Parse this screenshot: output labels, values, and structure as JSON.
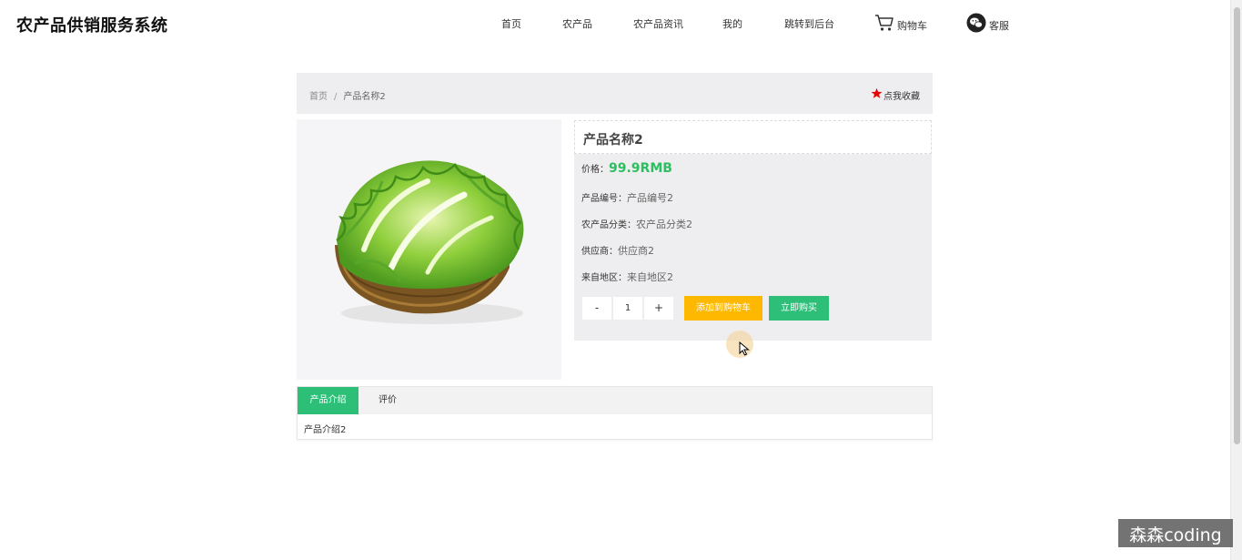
{
  "header": {
    "site_title": "农产品供销服务系统",
    "nav": [
      {
        "label": "首页"
      },
      {
        "label": "农产品"
      },
      {
        "label": "农产品资讯"
      },
      {
        "label": "我的"
      },
      {
        "label": "跳转到后台"
      },
      {
        "label": "购物车",
        "icon": "cart-icon"
      },
      {
        "label": "客服",
        "icon": "wechat-icon"
      }
    ]
  },
  "breadcrumb": {
    "home": "首页",
    "separator": "/",
    "current": "产品名称2",
    "favorite_label": "点我收藏"
  },
  "product": {
    "name": "产品名称2",
    "price_label": "价格：",
    "price": "99.9RMB",
    "code_label": "产品编号：",
    "code": "产品编号2",
    "category_label": "农产品分类：",
    "category": "农产品分类2",
    "supplier_label": "供应商：",
    "supplier": "供应商2",
    "origin_label": "来自地区：",
    "origin": "来自地区2",
    "image_icon": "lettuce-basket-image"
  },
  "purchase": {
    "minus": "-",
    "quantity": "1",
    "plus": "+",
    "add_to_cart": "添加到购物车",
    "buy_now": "立即购买"
  },
  "tabs": {
    "items": [
      {
        "label": "产品介绍",
        "active": true
      },
      {
        "label": "评价",
        "active": false
      }
    ],
    "content": "产品介绍2"
  },
  "watermark": "森森coding",
  "colors": {
    "accent_green": "#2dbe78",
    "price_green": "#2dbe60",
    "cart_orange": "#ffb800",
    "favorite_star": "#e60000"
  }
}
